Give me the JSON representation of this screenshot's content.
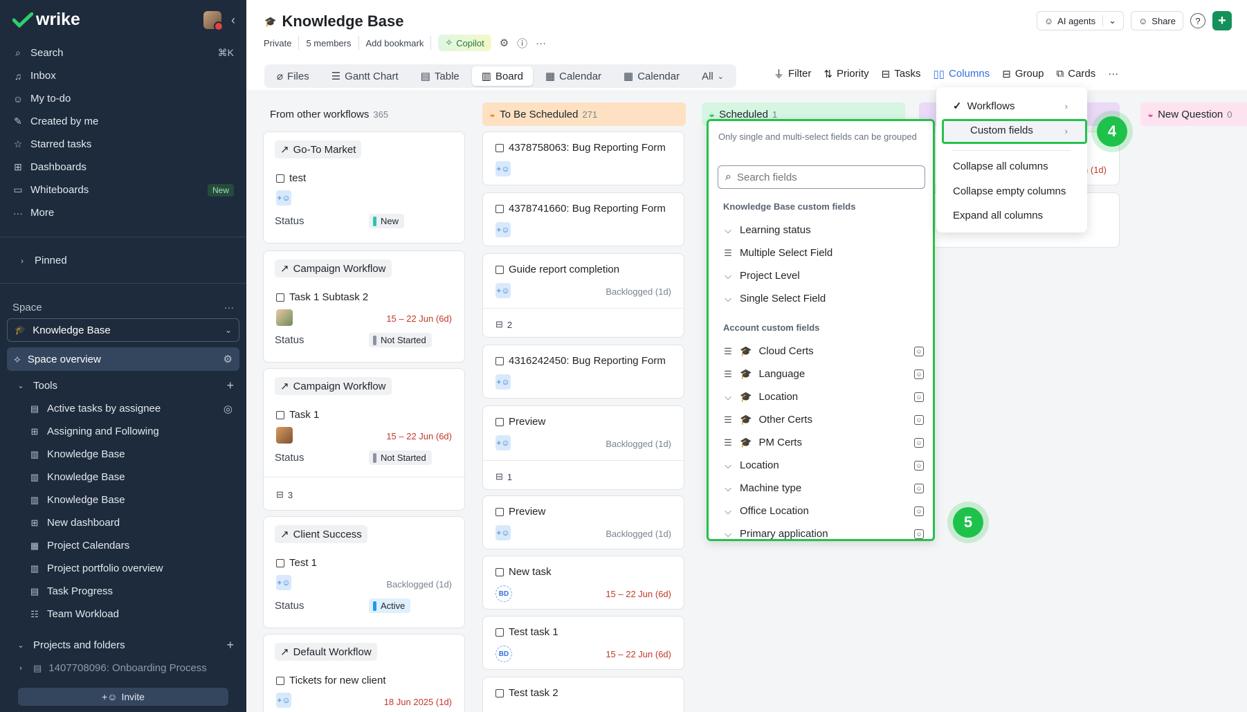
{
  "sidebar": {
    "brand": "wrike",
    "nav": [
      {
        "label": "Search",
        "icon": "search-icon",
        "shortcut": "⌘K"
      },
      {
        "label": "Inbox",
        "icon": "bell-icon"
      },
      {
        "label": "My to-do",
        "icon": "user-icon"
      },
      {
        "label": "Created by me",
        "icon": "pencil-icon"
      },
      {
        "label": "Starred tasks",
        "icon": "star-icon"
      },
      {
        "label": "Dashboards",
        "icon": "dashboard-icon"
      },
      {
        "label": "Whiteboards",
        "icon": "whiteboard-icon",
        "badge": "New"
      },
      {
        "label": "More",
        "icon": "more-icon"
      }
    ],
    "pinned": "Pinned",
    "space_label": "Space",
    "space_name": "Knowledge Base",
    "space_overview": "Space overview",
    "tools_label": "Tools",
    "tools": [
      {
        "label": "Active tasks by assignee",
        "icon": "report-icon"
      },
      {
        "label": "Assigning and Following",
        "icon": "dashboard-icon"
      },
      {
        "label": "Knowledge Base",
        "icon": "chart-icon"
      },
      {
        "label": "Knowledge Base",
        "icon": "chart-icon"
      },
      {
        "label": "Knowledge Base",
        "icon": "chart-icon"
      },
      {
        "label": "New dashboard",
        "icon": "dashboard-icon"
      },
      {
        "label": "Project Calendars",
        "icon": "calendar-icon"
      },
      {
        "label": "Project portfolio overview",
        "icon": "chart-icon"
      },
      {
        "label": "Task Progress",
        "icon": "report-icon"
      },
      {
        "label": "Team Workload",
        "icon": "workload-icon"
      }
    ],
    "projects_label": "Projects and folders",
    "project_item": "1407708096: Onboarding Process",
    "invite": "Invite"
  },
  "header": {
    "title": "Knowledge Base",
    "meta": [
      "Private",
      "5 members",
      "Add bookmark"
    ],
    "copilot": "Copilot",
    "ai_agents": "AI agents",
    "share": "Share",
    "views": [
      {
        "label": "Files",
        "icon": "paperclip-icon"
      },
      {
        "label": "Gantt Chart",
        "icon": "gantt-icon"
      },
      {
        "label": "Table",
        "icon": "table-icon"
      },
      {
        "label": "Board",
        "icon": "board-icon",
        "active": true
      },
      {
        "label": "Calendar",
        "icon": "calendar-icon"
      },
      {
        "label": "Calendar",
        "icon": "calendar-icon"
      }
    ],
    "views_all": "All",
    "toolbar": {
      "filter": "Filter",
      "priority": "Priority",
      "tasks": "Tasks",
      "columns": "Columns",
      "group": "Group",
      "cards": "Cards"
    }
  },
  "board": {
    "columns": [
      {
        "title": "From other workflows",
        "count": "365"
      },
      {
        "title": "To Be Scheduled",
        "count": "271",
        "color": "#fde1c2"
      },
      {
        "title": "Scheduled",
        "count": "1",
        "color": "#d6f5e3"
      },
      {
        "title": "New Question",
        "count": "0",
        "color": "#fde3ef"
      }
    ],
    "col1": [
      {
        "workflow": "Go-To Market",
        "task": "test",
        "status": "New",
        "status_color": "#2bc4b4"
      },
      {
        "workflow": "Campaign Workflow",
        "task": "Task 1 Subtask 2",
        "date": "15 – 22 Jun (6d)",
        "status": "Not Started",
        "status_color": "#8a93a0"
      },
      {
        "workflow": "Campaign Workflow",
        "task": "Task 1",
        "date": "15 – 22 Jun (6d)",
        "status": "Not Started",
        "status_color": "#8a93a0",
        "subtasks": "3"
      },
      {
        "workflow": "Client Success",
        "task": "Test 1",
        "date": "Backlogged (1d)",
        "status": "Active",
        "status_color": "#1d9bf0"
      },
      {
        "workflow": "Default Workflow",
        "task": "Tickets for new client",
        "date": "18 Jun 2025 (1d)"
      }
    ],
    "status_label": "Status",
    "col2": [
      {
        "task": "4378758063: Bug Reporting Form"
      },
      {
        "task": "4378741660: Bug Reporting Form"
      },
      {
        "task": "Guide report completion",
        "date": "Backlogged (1d)",
        "subtasks": "2"
      },
      {
        "task": "4316242450: Bug Reporting Form"
      },
      {
        "task": "Preview",
        "date": "Backlogged (1d)",
        "subtasks": "1"
      },
      {
        "task": "Preview",
        "date": "Backlogged (1d)"
      },
      {
        "task": "New task",
        "date": "15 – 22 Jun (6d)",
        "assignee": "BD"
      },
      {
        "task": "Test task 1",
        "date": "15 – 22 Jun (6d)",
        "assignee": "BD"
      },
      {
        "task": "Test task 2"
      }
    ],
    "hidden_date": "n (1d)"
  },
  "field_panel": {
    "note": "Only single and multi-select fields can be grouped",
    "search_placeholder": "Search fields",
    "group1": "Knowledge Base custom fields",
    "group1_items": [
      {
        "label": "Learning status",
        "type": "single"
      },
      {
        "label": "Multiple Select Field",
        "type": "multi"
      },
      {
        "label": "Project Level",
        "type": "single"
      },
      {
        "label": "Single Select Field",
        "type": "single"
      }
    ],
    "group2": "Account custom fields",
    "group2_items": [
      {
        "label": "Cloud Certs",
        "type": "multi",
        "cap": true
      },
      {
        "label": "Language",
        "type": "multi",
        "cap": true
      },
      {
        "label": "Location",
        "type": "single",
        "cap": true
      },
      {
        "label": "Other Certs",
        "type": "multi",
        "cap": true
      },
      {
        "label": "PM Certs",
        "type": "multi",
        "cap": true
      },
      {
        "label": "Location",
        "type": "single"
      },
      {
        "label": "Machine type",
        "type": "single"
      },
      {
        "label": "Office Location",
        "type": "single"
      },
      {
        "label": "Primary application",
        "type": "single"
      }
    ]
  },
  "columns_menu": {
    "workflows": "Workflows",
    "custom_fields": "Custom fields",
    "collapse_all": "Collapse all columns",
    "collapse_empty": "Collapse empty columns",
    "expand_all": "Expand all columns"
  },
  "steps": [
    "4",
    "5"
  ],
  "colors": {
    "accent": "#24c24a",
    "sidebar": "#1d2b3c",
    "columns_blue": "#2f6fdf",
    "brand_green": "#14915a"
  }
}
